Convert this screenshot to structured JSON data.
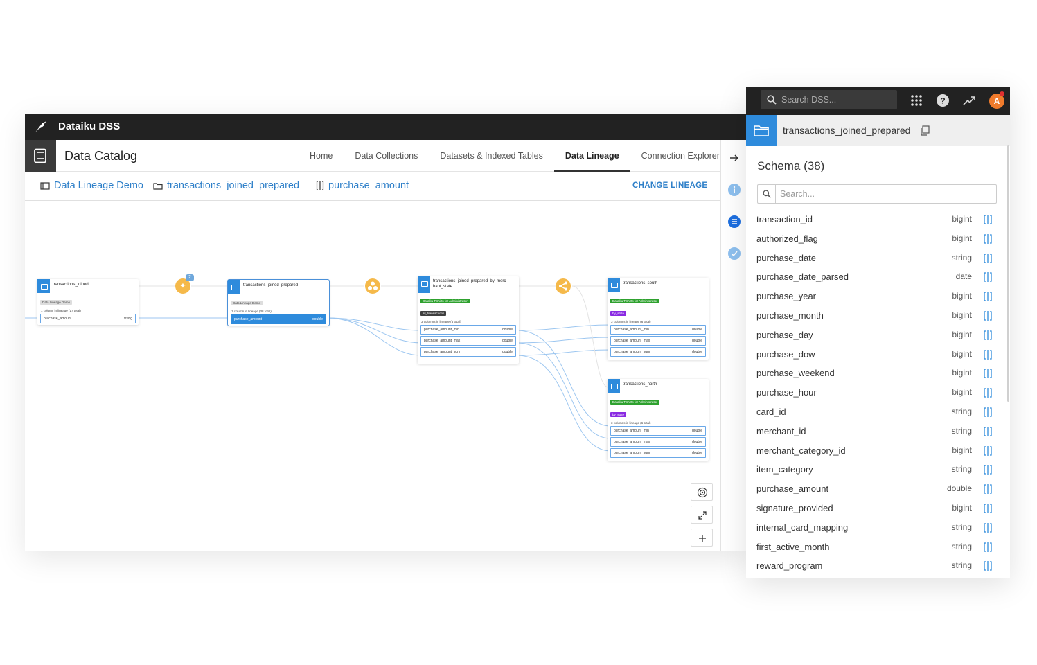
{
  "app": {
    "title": "Dataiku DSS"
  },
  "catalog": {
    "title": "Data Catalog",
    "tabs": [
      {
        "label": "Home"
      },
      {
        "label": "Data Collections"
      },
      {
        "label": "Datasets & Indexed Tables"
      },
      {
        "label": "Data Lineage",
        "active": true
      },
      {
        "label": "Connection Explorer"
      }
    ]
  },
  "breadcrumb": {
    "project": "Data Lineage Demo",
    "dataset": "transactions_joined_prepared",
    "column": "purchase_amount",
    "action": "CHANGE LINEAGE"
  },
  "graph": {
    "nodes": [
      {
        "id": "n1",
        "name": "transactions_joined",
        "tags": [
          {
            "text": "Data Lineage Demo",
            "color": "grey"
          }
        ],
        "lineage": "1 column in lineage (17 total)",
        "columns": [
          {
            "name": "purchase_amount",
            "type": "string"
          }
        ]
      },
      {
        "id": "n2",
        "name": "transactions_joined_prepared",
        "tags": [
          {
            "text": "Data Lineage Demo",
            "color": "grey"
          }
        ],
        "lineage": "1 column in lineage (38 total)",
        "columns": [
          {
            "name": "purchase_amount",
            "type": "double",
            "active": true
          }
        ]
      },
      {
        "id": "n3",
        "name": "transactions_joined_prepared_by_merc hant_state",
        "tags": [
          {
            "text": "Dataiku TShirts for Administrator",
            "color": "green"
          },
          {
            "text": "all_transactions",
            "color": "dark"
          }
        ],
        "lineage": "3 columns in lineage (6 total)",
        "columns": [
          {
            "name": "purchase_amount_min",
            "type": "double"
          },
          {
            "name": "purchase_amount_max",
            "type": "double"
          },
          {
            "name": "purchase_amount_sum",
            "type": "double"
          }
        ]
      },
      {
        "id": "n4",
        "name": "transactions_south",
        "tags": [
          {
            "text": "Dataiku TShirts for Administrator",
            "color": "green"
          },
          {
            "text": "by_state",
            "color": "purple"
          }
        ],
        "lineage": "3 columns in lineage (6 total)",
        "columns": [
          {
            "name": "purchase_amount_min",
            "type": "double"
          },
          {
            "name": "purchase_amount_max",
            "type": "double"
          },
          {
            "name": "purchase_amount_sum",
            "type": "double"
          }
        ]
      },
      {
        "id": "n5",
        "name": "transactions_north",
        "tags": [
          {
            "text": "Dataiku TShirts for Administrator",
            "color": "green"
          },
          {
            "text": "by_state",
            "color": "purple"
          }
        ],
        "lineage": "3 columns in lineage (6 total)",
        "columns": [
          {
            "name": "purchase_amount_min",
            "type": "double"
          },
          {
            "name": "purchase_amount_max",
            "type": "double"
          },
          {
            "name": "purchase_amount_sum",
            "type": "double"
          }
        ]
      }
    ],
    "recipes": [
      {
        "kind": "prepare",
        "icon": "broom-icon",
        "badge": "2"
      },
      {
        "kind": "group",
        "icon": "group-icon"
      },
      {
        "kind": "split",
        "icon": "split-icon"
      }
    ]
  },
  "dss": {
    "search_placeholder": "Search DSS...",
    "avatar_letter": "A"
  },
  "schema_panel": {
    "dataset": "transactions_joined_prepared",
    "title": "Schema (38)",
    "search_placeholder": "Search...",
    "fields": [
      {
        "name": "transaction_id",
        "type": "bigint"
      },
      {
        "name": "authorized_flag",
        "type": "bigint"
      },
      {
        "name": "purchase_date",
        "type": "string"
      },
      {
        "name": "purchase_date_parsed",
        "type": "date"
      },
      {
        "name": "purchase_year",
        "type": "bigint"
      },
      {
        "name": "purchase_month",
        "type": "bigint"
      },
      {
        "name": "purchase_day",
        "type": "bigint"
      },
      {
        "name": "purchase_dow",
        "type": "bigint"
      },
      {
        "name": "purchase_weekend",
        "type": "bigint"
      },
      {
        "name": "purchase_hour",
        "type": "bigint"
      },
      {
        "name": "card_id",
        "type": "string"
      },
      {
        "name": "merchant_id",
        "type": "string"
      },
      {
        "name": "merchant_category_id",
        "type": "bigint"
      },
      {
        "name": "item_category",
        "type": "string"
      },
      {
        "name": "purchase_amount",
        "type": "double"
      },
      {
        "name": "signature_provided",
        "type": "bigint"
      },
      {
        "name": "internal_card_mapping",
        "type": "string"
      },
      {
        "name": "first_active_month",
        "type": "string"
      },
      {
        "name": "reward_program",
        "type": "string"
      }
    ]
  },
  "colors": {
    "accent": "#2e8bdc",
    "recipe": "#f5b94a",
    "topbar": "#222222",
    "link": "#2f80c9"
  }
}
